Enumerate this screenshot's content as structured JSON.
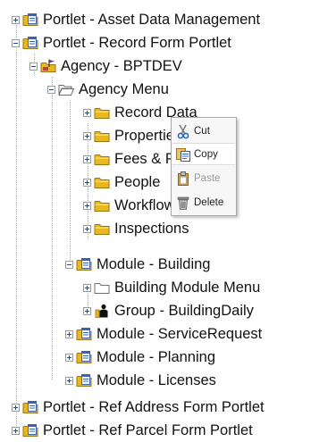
{
  "tree": {
    "nodes": [
      {
        "label": "Portlet - Asset Data Management",
        "icon": "folder-form-icon",
        "state": "collapsed"
      },
      {
        "label": "Portlet - Record Form Portlet",
        "icon": "folder-form-icon",
        "state": "expanded"
      },
      {
        "label": "Agency - BPTDEV",
        "icon": "agency-folder-icon",
        "state": "expanded"
      },
      {
        "label": "Agency Menu",
        "icon": "open-folder-icon",
        "state": "expanded"
      },
      {
        "label": "Record Data",
        "icon": "folder-icon",
        "state": "collapsed"
      },
      {
        "label": "Properties",
        "icon": "folder-icon",
        "state": "collapsed"
      },
      {
        "label": "Fees & Payments",
        "icon": "folder-icon",
        "state": "collapsed"
      },
      {
        "label": "People",
        "icon": "folder-icon",
        "state": "collapsed"
      },
      {
        "label": "Workflow",
        "icon": "folder-icon",
        "state": "collapsed"
      },
      {
        "label": "Inspections",
        "icon": "folder-icon",
        "state": "collapsed"
      },
      {
        "label": "Module - Building",
        "icon": "folder-form-icon",
        "state": "expanded"
      },
      {
        "label": "Building Module Menu",
        "icon": "white-folder-icon",
        "state": "collapsed"
      },
      {
        "label": "Group - BuildingDaily",
        "icon": "group-icon",
        "state": "collapsed"
      },
      {
        "label": "Module - ServiceRequest",
        "icon": "folder-form-icon",
        "state": "collapsed"
      },
      {
        "label": "Module - Planning",
        "icon": "folder-form-icon",
        "state": "collapsed"
      },
      {
        "label": "Module - Licenses",
        "icon": "folder-form-icon",
        "state": "collapsed"
      },
      {
        "label": "Portlet - Ref Address Form Portlet",
        "icon": "folder-form-icon",
        "state": "collapsed"
      },
      {
        "label": "Portlet - Ref Parcel Form Portlet",
        "icon": "folder-form-icon",
        "state": "collapsed"
      }
    ]
  },
  "context_menu": {
    "items": [
      {
        "label": "Cut",
        "icon": "scissors-icon",
        "enabled": true
      },
      {
        "label": "Copy",
        "icon": "copy-icon",
        "enabled": true,
        "highlighted": true
      },
      {
        "label": "Paste",
        "icon": "clipboard-icon",
        "enabled": false
      },
      {
        "label": "Delete",
        "icon": "trash-icon",
        "enabled": true
      }
    ]
  },
  "colors": {
    "folder": "#e8b820",
    "folder_dark": "#9c7410",
    "form_blue": "#3a62b0",
    "tree_line": "#9aa0a6"
  }
}
